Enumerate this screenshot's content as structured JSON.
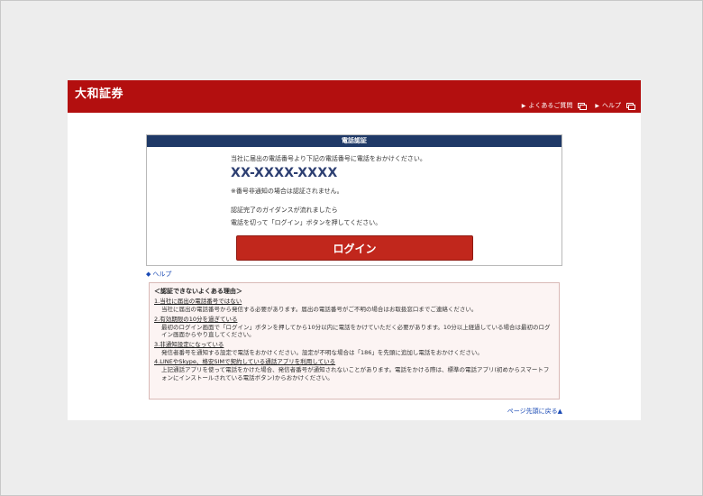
{
  "header": {
    "logo": "大和証券",
    "faq_link": "よくあるご質問",
    "help_link": "ヘルプ"
  },
  "panel": {
    "title": "電話認証",
    "instruction": "当社に届出の電話番号より下記の電話番号に電話をおかけください。",
    "phone_number": "XX-XXXX-XXXX",
    "note": "※番号非通知の場合は認証されません。",
    "guide_line1": "認証完了のガイダンスが流れましたら",
    "guide_line2": "電話を切って「ログイン」ボタンを押してください。",
    "login_button": "ログイン"
  },
  "help": {
    "label": "ヘルプ"
  },
  "reasons": {
    "title": "＜認証できないよくある理由＞",
    "items": [
      {
        "heading": "1.当社に届出の電話番号ではない",
        "desc": "当社に届出の電話番号から発信する必要があります。届出の電話番号がご不明の場合はお取扱窓口までご連絡ください。"
      },
      {
        "heading": "2.有効期限の10分を過ぎている",
        "desc": "最初のログイン画面で「ログイン」ボタンを押してから10分以内に電話をかけていただく必要があります。10分以上経過している場合は最初のログイン画面からやり直してください。"
      },
      {
        "heading": "3.非通知設定になっている",
        "desc": "発信者番号を通知する設定で電話をおかけください。設定が不明な場合は「186」を先頭に追加し電話をおかけください。"
      },
      {
        "heading": "4.LINEやSkype、格安SIMで契約している通話アプリを利用している",
        "desc": "上記通話アプリを使って電話をかけた場合、発信者番号が通知されないことがあります。電話をかける際は、標準の電話アプリ(初めからスマートフォンにインストールされている電話ボタン)からおかけください。"
      }
    ]
  },
  "footer": {
    "page_top": "ページ先頭に戻る▲"
  },
  "colors": {
    "header_red": "#b30f0f",
    "panel_navy": "#1f3967",
    "button_red": "#c1271c",
    "link_blue": "#1a4ab5",
    "reasons_bg": "#fcf4f3"
  }
}
